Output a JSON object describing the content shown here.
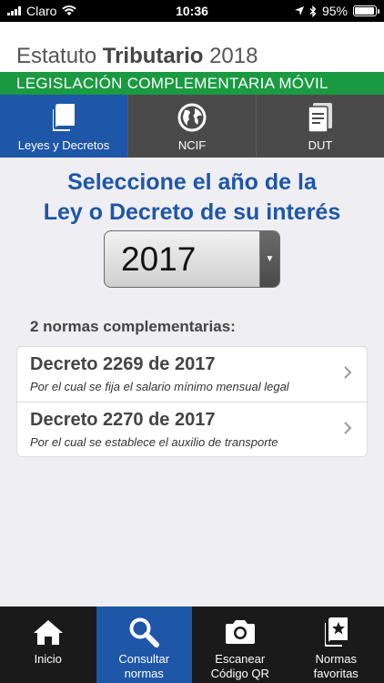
{
  "statusbar": {
    "carrier": "Claro",
    "time": "10:36",
    "battery": "95%",
    "battery_level": 0.95
  },
  "header": {
    "title_prefix": "Estatuto ",
    "title_bold": "Tributario",
    "title_suffix": " 2018",
    "subtitle": "LEGISLACIÓN COMPLEMENTARIA MÓVIL"
  },
  "tabs": [
    {
      "label": "Leyes y Decretos",
      "icon": "book-icon",
      "active": true
    },
    {
      "label": "NCIF",
      "icon": "globe-icon",
      "active": false
    },
    {
      "label": "DUT",
      "icon": "document-icon",
      "active": false
    }
  ],
  "main": {
    "prompt_line1": "Seleccione el año de la",
    "prompt_line2": "Ley o Decreto de su interés",
    "selected_year": "2017",
    "count_label": "2 normas complementarias:",
    "items": [
      {
        "title": "Decreto 2269 de 2017",
        "desc": "Por el cual se fija el salario mínimo mensual legal"
      },
      {
        "title": "Decreto 2270 de 2017",
        "desc": "Por el cual se establece el auxilio de transporte"
      }
    ]
  },
  "bottom_tabs": [
    {
      "label": "Inicio",
      "icon": "home-icon",
      "active": false
    },
    {
      "label": "Consultar\nnormas",
      "icon": "search-icon",
      "active": true
    },
    {
      "label": "Escanear\nCódigo QR",
      "icon": "camera-icon",
      "active": false
    },
    {
      "label": "Normas\nfavoritas",
      "icon": "star-document-icon",
      "active": false
    }
  ],
  "colors": {
    "accent_blue": "#1e56a8",
    "green": "#1a9a41",
    "dark_tab": "#4a4a4a",
    "bottom_bar": "#1a1a1a"
  }
}
